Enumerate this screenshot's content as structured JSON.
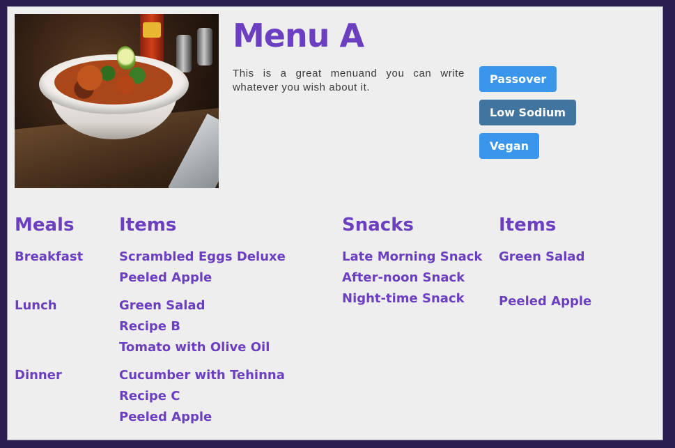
{
  "menu": {
    "title": "Menu A",
    "description": "This is a great menuand you can write whatever you wish about it.",
    "tags": [
      "Passover",
      "Low Sodium",
      "Vegan"
    ]
  },
  "meals_table": {
    "header_meals": "Meals",
    "header_items": "Items",
    "rows": [
      {
        "meal": "Breakfast",
        "items": [
          "Scrambled Eggs Deluxe",
          "Peeled Apple"
        ]
      },
      {
        "meal": "Lunch",
        "items": [
          "Green Salad",
          "Recipe B",
          "Tomato with Olive Oil"
        ]
      },
      {
        "meal": "Dinner",
        "items": [
          "Cucumber with Tehinna",
          "Recipe C",
          "Peeled Apple"
        ]
      }
    ]
  },
  "snacks_table": {
    "header_snacks": "Snacks",
    "header_items": "Items",
    "snacks": [
      "Late Morning Snack",
      "After-noon Snack",
      "Night-time Snack"
    ],
    "items": [
      "Green Salad",
      "Peeled Apple"
    ]
  },
  "colors": {
    "accent": "#6b3fc0",
    "tag_blue": "#3a96ea",
    "tag_slate": "#41759f",
    "frame": "#2b1d4f",
    "card_bg": "#eeeeee"
  }
}
